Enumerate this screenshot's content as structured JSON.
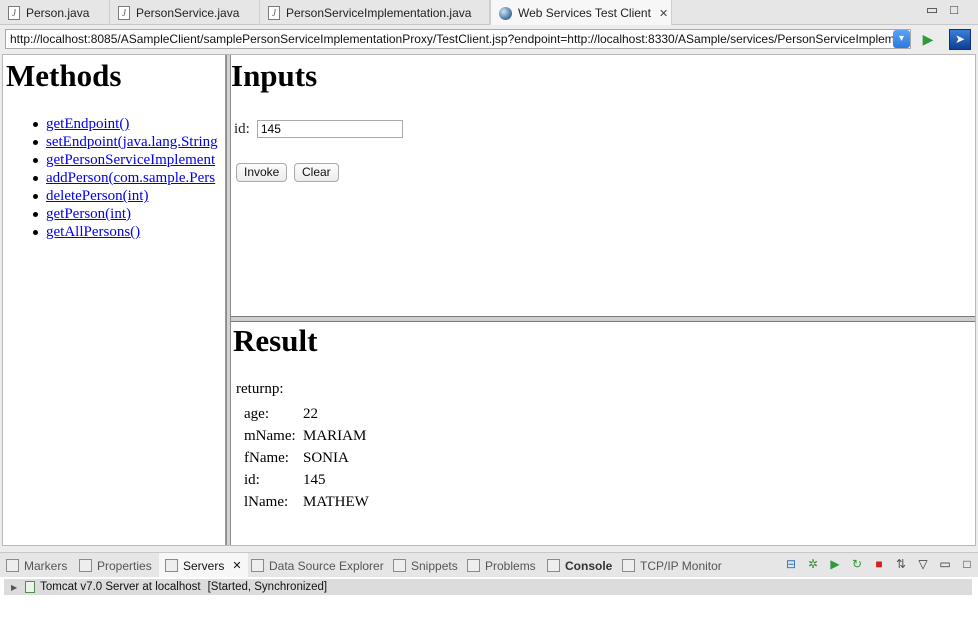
{
  "editor_tabs": [
    {
      "label": "Person.java",
      "icon": "java-file-icon"
    },
    {
      "label": "PersonService.java",
      "icon": "java-file-icon"
    },
    {
      "label": "PersonServiceImplementation.java",
      "icon": "java-file-icon"
    },
    {
      "label": "Web Services Test Client",
      "icon": "globe-icon",
      "active": true
    }
  ],
  "url": "http://localhost:8085/ASampleClient/samplePersonServiceImplementationProxy/TestClient.jsp?endpoint=http://localhost:8330/ASample/services/PersonServiceImpleme",
  "methods": {
    "title": "Methods",
    "items": [
      "getEndpoint()",
      "setEndpoint(java.lang.String",
      "getPersonServiceImplement",
      "addPerson(com.sample.Pers",
      "deletePerson(int)",
      "getPerson(int)",
      "getAllPersons()"
    ]
  },
  "inputs": {
    "title": "Inputs",
    "id_label": "id:",
    "id_value": "145",
    "invoke_label": "Invoke",
    "clear_label": "Clear"
  },
  "result": {
    "title": "Result",
    "return_label": "returnp:",
    "fields": [
      {
        "key": "age:",
        "value": "22"
      },
      {
        "key": "mName:",
        "value": "MARIAM"
      },
      {
        "key": "fName:",
        "value": "SONIA"
      },
      {
        "key": "id:",
        "value": "145"
      },
      {
        "key": "lName:",
        "value": "MATHEW"
      }
    ]
  },
  "view_tabs": [
    {
      "label": "Markers"
    },
    {
      "label": "Properties"
    },
    {
      "label": "Servers",
      "active": true
    },
    {
      "label": "Data Source Explorer"
    },
    {
      "label": "Snippets"
    },
    {
      "label": "Problems"
    },
    {
      "label": "Console"
    },
    {
      "label": "TCP/IP Monitor"
    }
  ],
  "servers": {
    "name": "Tomcat v7.0 Server at localhost",
    "status": "[Started, Synchronized]"
  },
  "colors": {
    "link": "#0000ee",
    "accent": "#2d78e0"
  }
}
